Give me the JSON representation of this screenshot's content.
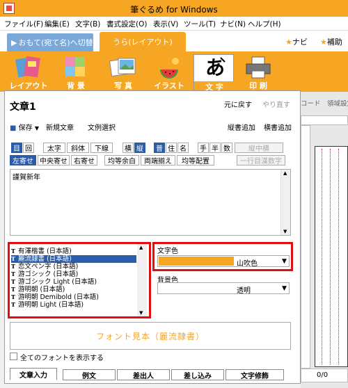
{
  "window": {
    "title": "筆ぐるめ for Windows"
  },
  "menu": [
    "ファイル(F)",
    "編集(E)",
    "文字(B)",
    "書式設定(O)",
    "表示(V)",
    "ツール(T)",
    "ナビ(N)",
    "ヘルプ(H)"
  ],
  "top_tabs": {
    "omote": "おもて(宛て名)へ切替",
    "ura": "うら(レイアウト)",
    "navi": "ナビ",
    "help": "補助"
  },
  "ribbon": [
    "レイアウト",
    "背 景",
    "写 真",
    "イラスト",
    "文 字",
    "印 刷"
  ],
  "panel": {
    "title": "文章1",
    "undo": "元に戻す",
    "redo": "やり直す",
    "save": "保存",
    "new_text": "新規文章",
    "text_select": "文例選択",
    "vert_add": "縦書追加",
    "horiz_add": "横書追加",
    "row1": [
      "目",
      "回",
      "太字",
      "斜体",
      "下線",
      "横",
      "縦",
      "普",
      "住",
      "名",
      "手",
      "半",
      "数",
      "縦中横"
    ],
    "row2": [
      "左寄せ",
      "中央寄せ",
      "右寄せ",
      "均等余白",
      "両端揃え",
      "均等配置",
      "一行目漢数字"
    ],
    "text_content": "謹賀新年"
  },
  "fonts": {
    "items": [
      "有澤楷書 (日本語)",
      "麗流隷書 (日本語)",
      "恋文ペン字 (日本語)",
      "游ゴシック (日本語)",
      "游ゴシック Light (日本語)",
      "游明朝 (日本語)",
      "游明朝 Demibold (日本語)",
      "游明朝 Light (日本語)"
    ],
    "selected_index": 1,
    "tt_icon": "T"
  },
  "color": {
    "label": "文字色",
    "value": "山吹色",
    "swatch": "#f6a623"
  },
  "bgcolor": {
    "label": "背景色",
    "value": "透明"
  },
  "preview": "フォント見本（麗流隷書）",
  "show_all_fonts": "全てのフォントを表示する",
  "bottom_tabs": [
    "文章入力",
    "例文",
    "差出人",
    "差し込み",
    "文字修飾"
  ],
  "right": {
    "labels": "コード　領域設定",
    "page_count": "0/0"
  }
}
